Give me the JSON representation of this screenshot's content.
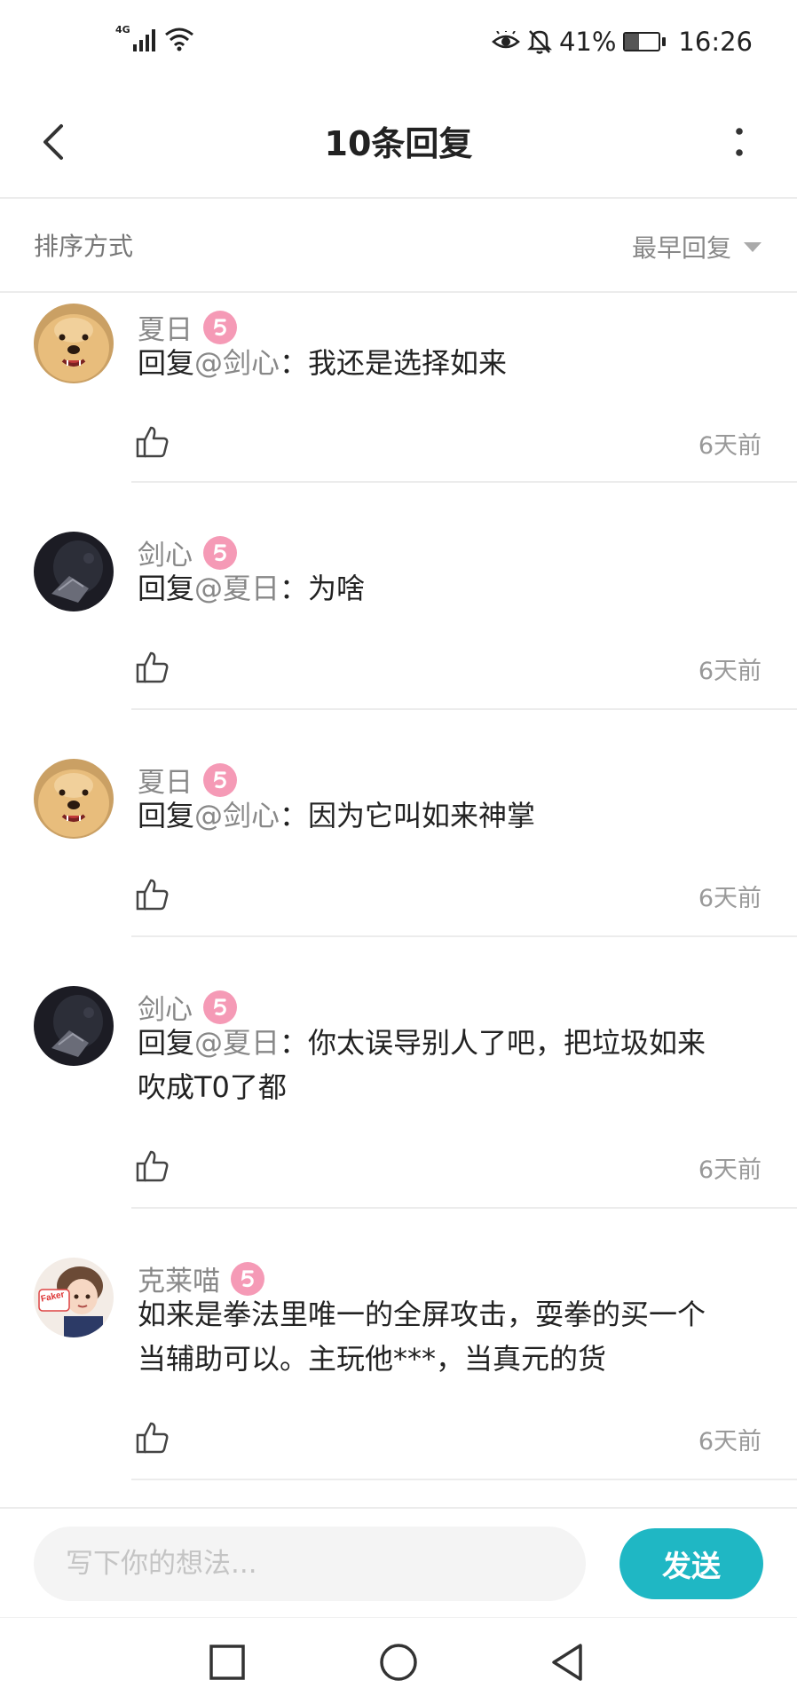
{
  "status_bar": {
    "network_type": "4G",
    "battery_percent": "41%",
    "battery_level": 0.41,
    "time": "16:26",
    "icons": [
      "signal-icon",
      "wifi-icon",
      "eye-comfort-icon",
      "mute-icon",
      "battery-icon"
    ]
  },
  "nav": {
    "title": "10条回复",
    "back_icon": "chevron-left-icon",
    "more_icon": "more-vertical-icon"
  },
  "sort": {
    "label": "排序方式",
    "selected": "最早回复"
  },
  "replies": [
    {
      "username": "夏日",
      "level": "5",
      "prefix": "回复",
      "mention": "@剑心",
      "separator": "：",
      "text": "我还是选择如来",
      "time": "6天前",
      "avatar": "dog-avatar"
    },
    {
      "username": "剑心",
      "level": "5",
      "prefix": "回复",
      "mention": "@夏日",
      "separator": "：",
      "text": "为啥",
      "time": "6天前",
      "avatar": "dark-avatar"
    },
    {
      "username": "夏日",
      "level": "5",
      "prefix": "回复",
      "mention": "@剑心",
      "separator": "：",
      "text": "因为它叫如来神掌",
      "time": "6天前",
      "avatar": "dog-avatar"
    },
    {
      "username": "剑心",
      "level": "5",
      "prefix": "回复",
      "mention": "@夏日",
      "separator": "：",
      "text_line1": "你太误导别人了吧，把垃圾如来",
      "text_line2": "吹成T0了都",
      "time": "6天前",
      "avatar": "dark-avatar"
    },
    {
      "username": "克莱喵",
      "level": "5",
      "text_line1": "如来是拳法里唯一的全屏攻击，耍拳的买一个",
      "text_line2": "当辅助可以。主玩他***，当真元的货",
      "time": "6天前",
      "avatar": "cartoon-avatar",
      "avatar_text": "Faker"
    }
  ],
  "input": {
    "placeholder": "写下你的想法...",
    "send_label": "发送"
  },
  "system_nav": [
    "recents-square-icon",
    "home-circle-icon",
    "back-triangle-icon"
  ],
  "colors": {
    "accent": "#1fb7c4",
    "level_badge": "#f59ab6",
    "muted_text": "#888888"
  }
}
